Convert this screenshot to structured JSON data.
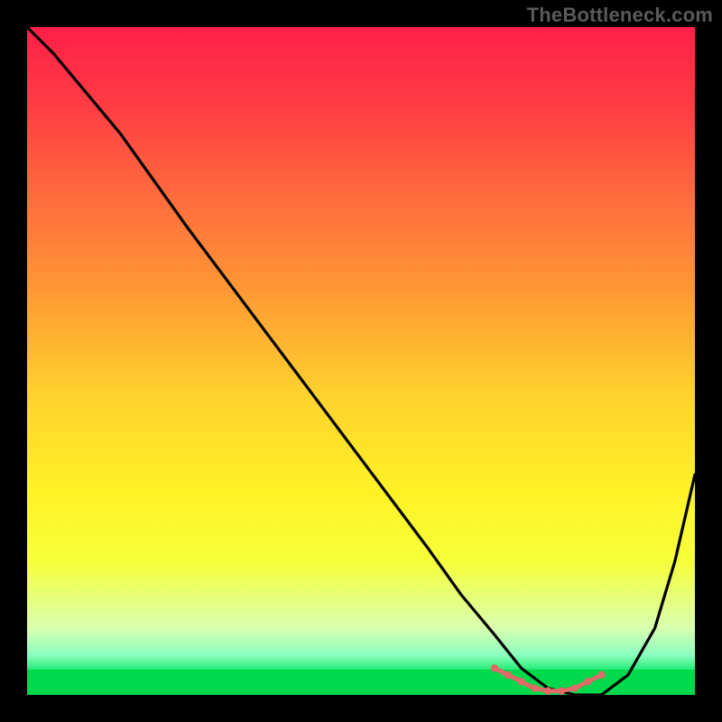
{
  "watermark": "TheBottleneck.com",
  "colors": {
    "background": "#000000",
    "gradient_top": "#ff1f48",
    "gradient_bottom": "#00d94c",
    "curve_main": "#000000",
    "curve_accent": "#e06a66",
    "watermark_text": "#5a5a5a"
  },
  "chart_data": {
    "type": "line",
    "title": "",
    "xlabel": "",
    "ylabel": "",
    "xlim": [
      0,
      100
    ],
    "ylim": [
      0,
      100
    ],
    "grid": false,
    "legend": false,
    "series": [
      {
        "name": "bottleneck-curve",
        "x": [
          0,
          4,
          9,
          14,
          19,
          24,
          30,
          36,
          42,
          48,
          54,
          60,
          65,
          70,
          74,
          78,
          82,
          86,
          90,
          94,
          97,
          100
        ],
        "y": [
          100,
          96,
          90,
          84,
          77,
          70,
          62,
          54,
          46,
          38,
          30,
          22,
          15,
          9,
          4,
          1,
          0,
          0,
          3,
          10,
          20,
          33
        ]
      }
    ],
    "accent_region": {
      "name": "valley-dots",
      "x": [
        70,
        72,
        74,
        76,
        78,
        80,
        82,
        84,
        86
      ],
      "y": [
        4,
        3,
        2,
        1,
        0.6,
        0.6,
        1,
        2,
        3
      ]
    }
  }
}
